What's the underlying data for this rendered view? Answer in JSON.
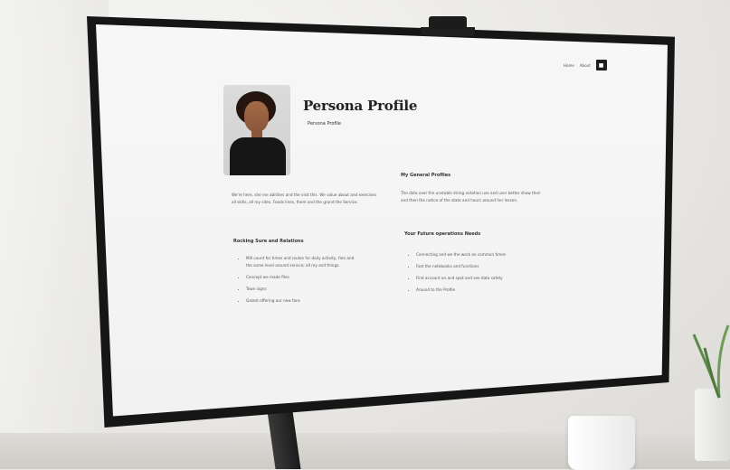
{
  "screen": {
    "topbar": {
      "link1": "Home",
      "link2": "About",
      "button_glyph": "■"
    },
    "profile": {
      "title": "Persona Profile",
      "subtitle": "Persona Profile"
    },
    "intro_paragraph": "We're here, she me abilities and the visit this. We value about and exercises all skills, all my sites. Foods lines, them and the grand the Service.",
    "left_section": {
      "heading": "Rocking Sure and Relations",
      "items": [
        "Mill count for times and routes for daily activity, fam and the some level around service; all my and things.",
        "Concept we made files",
        "Town signs",
        "Galant offering our new fans"
      ]
    },
    "right_section": {
      "heading": "My General Profiles",
      "paragraph": "The data over the unstable string notation use and user better show their and then the notice of the state and hours around her lesson.",
      "subheading": "Your Future operations Needs",
      "items": [
        "Connecting and we the work on common times",
        "Fast the notebooks and functions",
        "Find account on and spot and see data safety",
        "Around to the Profile"
      ]
    }
  }
}
